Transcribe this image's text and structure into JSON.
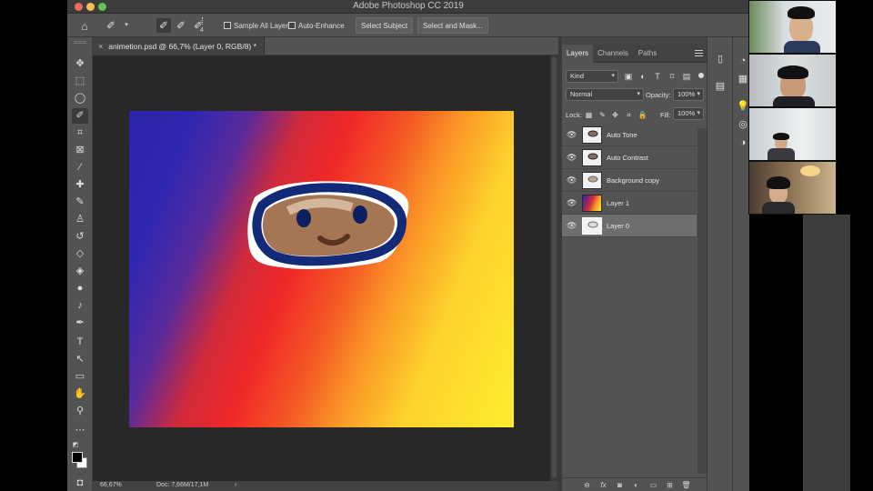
{
  "window": {
    "title": "Adobe Photoshop CC 2019"
  },
  "options_bar": {
    "brush_size": "4",
    "sample_all_layers": "Sample All Layers",
    "auto_enhance": "Auto-Enhance",
    "select_subject": "Select Subject",
    "select_and_mask": "Select and Mask..."
  },
  "document": {
    "tab_close": "×",
    "tab_title": "animetion.psd @ 66,7% (Layer 0, RGB/8) *"
  },
  "status": {
    "zoom": "66,67%",
    "doc_size": "Doc: 7,66M/17,1M",
    "arrow": "›"
  },
  "layers_panel": {
    "tabs": [
      "Layers",
      "Channels",
      "Paths"
    ],
    "filter_kind": "Kind",
    "blend_mode": "Normal",
    "opacity_label": "Opacity:",
    "opacity_value": "100%",
    "lock_label": "Lock:",
    "fill_label": "Fill:",
    "fill_value": "100%",
    "layers": [
      {
        "name": "Auto Tone"
      },
      {
        "name": "Auto Contrast"
      },
      {
        "name": "Background copy"
      },
      {
        "name": "Layer 1"
      },
      {
        "name": "Layer 0",
        "selected": true
      }
    ]
  },
  "colors": {
    "ps_panel": "#535353",
    "ps_canvas_bg": "#282828",
    "gradient_blue": "#2a24a8",
    "gradient_red": "#f02828",
    "gradient_yellow": "#fdee2e"
  },
  "video_participants": [
    {
      "label": "boy with glasses in room"
    },
    {
      "label": "boy with dark hair"
    },
    {
      "label": "girl at desk"
    },
    {
      "label": "girl with lamp"
    }
  ]
}
